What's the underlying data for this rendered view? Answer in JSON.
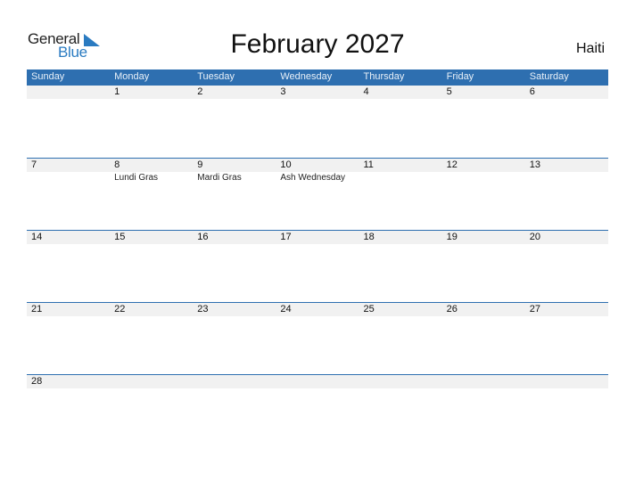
{
  "logo": {
    "general": "General",
    "blue": "Blue",
    "accent_color": "#2a7bc1"
  },
  "title": "February 2027",
  "country": "Haiti",
  "header_color": "#2e6fb0",
  "weekdays": [
    "Sunday",
    "Monday",
    "Tuesday",
    "Wednesday",
    "Thursday",
    "Friday",
    "Saturday"
  ],
  "weeks": [
    {
      "days": [
        "",
        "1",
        "2",
        "3",
        "4",
        "5",
        "6"
      ],
      "events": [
        "",
        "",
        "",
        "",
        "",
        "",
        ""
      ]
    },
    {
      "days": [
        "7",
        "8",
        "9",
        "10",
        "11",
        "12",
        "13"
      ],
      "events": [
        "",
        "Lundi Gras",
        "Mardi Gras",
        "Ash Wednesday",
        "",
        "",
        ""
      ]
    },
    {
      "days": [
        "14",
        "15",
        "16",
        "17",
        "18",
        "19",
        "20"
      ],
      "events": [
        "",
        "",
        "",
        "",
        "",
        "",
        ""
      ]
    },
    {
      "days": [
        "21",
        "22",
        "23",
        "24",
        "25",
        "26",
        "27"
      ],
      "events": [
        "",
        "",
        "",
        "",
        "",
        "",
        ""
      ]
    },
    {
      "days": [
        "28",
        "",
        "",
        "",
        "",
        "",
        ""
      ],
      "events": [
        "",
        "",
        "",
        "",
        "",
        "",
        ""
      ]
    }
  ]
}
